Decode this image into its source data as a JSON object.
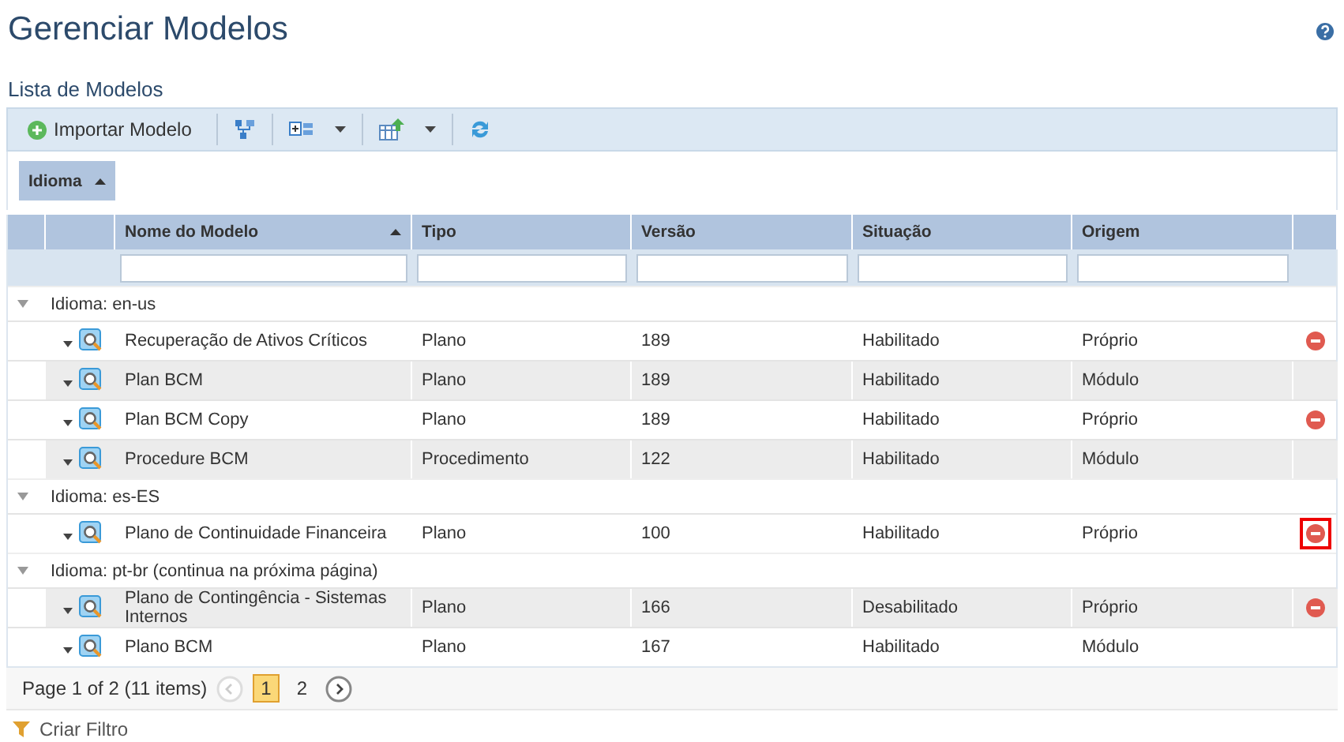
{
  "page": {
    "title": "Gerenciar Modelos"
  },
  "list_title": "Lista de Modelos",
  "toolbar": {
    "import_button": "Importar Modelo"
  },
  "grouping": {
    "chips": [
      {
        "label": "Idioma",
        "sorted": true
      }
    ]
  },
  "table": {
    "columns": [
      {
        "label": "Nome do Modelo",
        "sorted": true
      },
      {
        "label": "Tipo",
        "sorted": false
      },
      {
        "label": "Versão",
        "sorted": false
      },
      {
        "label": "Situação",
        "sorted": false
      },
      {
        "label": "Origem",
        "sorted": false
      }
    ],
    "groups": [
      {
        "label": "Idioma: en-us",
        "expanded": true,
        "rows": [
          {
            "name": "Recuperação de Ativos Críticos",
            "tipo": "Plano",
            "versao": "189",
            "situacao": "Habilitado",
            "origem": "Próprio",
            "deletable": true
          },
          {
            "name": "Plan BCM",
            "tipo": "Plano",
            "versao": "189",
            "situacao": "Habilitado",
            "origem": "Módulo",
            "deletable": false
          },
          {
            "name": "Plan BCM Copy",
            "tipo": "Plano",
            "versao": "189",
            "situacao": "Habilitado",
            "origem": "Próprio",
            "deletable": true
          },
          {
            "name": "Procedure BCM",
            "tipo": "Procedimento",
            "versao": "122",
            "situacao": "Habilitado",
            "origem": "Módulo",
            "deletable": false
          }
        ]
      },
      {
        "label": "Idioma: es-ES",
        "expanded": true,
        "rows": [
          {
            "name": "Plano de Continuidade Financeira",
            "tipo": "Plano",
            "versao": "100",
            "situacao": "Habilitado",
            "origem": "Próprio",
            "deletable": true,
            "highlighted": true
          }
        ]
      },
      {
        "label": "Idioma: pt-br (continua na próxima página)",
        "expanded": true,
        "rows": [
          {
            "name": "Plano de Contingência - Sistemas Internos",
            "tipo": "Plano",
            "versao": "166",
            "situacao": "Desabilitado",
            "origem": "Próprio",
            "deletable": true
          },
          {
            "name": "Plano BCM",
            "tipo": "Plano",
            "versao": "167",
            "situacao": "Habilitado",
            "origem": "Módulo",
            "deletable": false
          }
        ]
      }
    ]
  },
  "pager": {
    "summary": "Page 1 of 2 (11 items)",
    "pages": [
      {
        "label": "1",
        "selected": true
      },
      {
        "label": "2",
        "selected": false
      }
    ]
  },
  "footer": {
    "filter_link": "Criar Filtro"
  }
}
